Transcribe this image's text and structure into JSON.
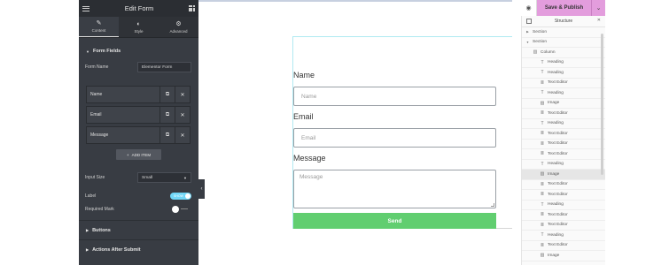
{
  "panel": {
    "header_title": "Edit Form",
    "tabs": [
      {
        "label": "Content",
        "icon": "pencil-icon"
      },
      {
        "label": "Style",
        "icon": "contrast-icon"
      },
      {
        "label": "Advanced",
        "icon": "gear-icon"
      }
    ],
    "section_title": "Form Fields",
    "form_name_label": "Form Name",
    "form_name_value": "Elementor Form",
    "fields": [
      "Name",
      "Email",
      "Message"
    ],
    "add_item_label": "ADD ITEM",
    "input_size_label": "Input Size",
    "input_size_value": "Small",
    "label_label": "Label",
    "label_toggle": "SHOW",
    "required_mark_label": "Required Mark",
    "collapsed_sections": [
      "Buttons",
      "Actions After Submit"
    ]
  },
  "form": {
    "name_label": "Name",
    "name_placeholder": "Name",
    "email_label": "Email",
    "email_placeholder": "Email",
    "message_label": "Message",
    "message_placeholder": "Message",
    "submit_label": "Send"
  },
  "topbar": {
    "publish_label": "Save & Publish"
  },
  "structure": {
    "title": "Structure",
    "items": [
      {
        "label": "Section",
        "icon": "triangle-right-icon",
        "level": 0
      },
      {
        "label": "Section",
        "icon": "triangle-down-icon",
        "level": 0
      },
      {
        "label": "Column",
        "icon": "column-icon",
        "level": 1
      },
      {
        "label": "Heading",
        "icon": "heading-icon",
        "level": 2
      },
      {
        "label": "Heading",
        "icon": "heading-icon",
        "level": 2
      },
      {
        "label": "Text Editor",
        "icon": "text-editor-icon",
        "level": 2
      },
      {
        "label": "Heading",
        "icon": "heading-icon",
        "level": 2
      },
      {
        "label": "Image",
        "icon": "image-icon",
        "level": 2
      },
      {
        "label": "Text Editor",
        "icon": "text-editor-icon",
        "level": 2
      },
      {
        "label": "Heading",
        "icon": "heading-icon",
        "level": 2
      },
      {
        "label": "Text Editor",
        "icon": "text-editor-icon",
        "level": 2
      },
      {
        "label": "Text Editor",
        "icon": "text-editor-icon",
        "level": 2
      },
      {
        "label": "Text Editor",
        "icon": "text-editor-icon",
        "level": 2
      },
      {
        "label": "Heading",
        "icon": "heading-icon",
        "level": 2
      },
      {
        "label": "Image",
        "icon": "image-icon",
        "level": 2
      },
      {
        "label": "Text Editor",
        "icon": "text-editor-icon",
        "level": 2
      },
      {
        "label": "Text Editor",
        "icon": "text-editor-icon",
        "level": 2
      },
      {
        "label": "Heading",
        "icon": "heading-icon",
        "level": 2
      },
      {
        "label": "Text Editor",
        "icon": "text-editor-icon",
        "level": 2
      },
      {
        "label": "Text Editor",
        "icon": "text-editor-icon",
        "level": 2
      },
      {
        "label": "Heading",
        "icon": "heading-icon",
        "level": 2
      },
      {
        "label": "Text Editor",
        "icon": "text-editor-icon",
        "level": 2
      },
      {
        "label": "Image",
        "icon": "image-icon",
        "level": 2
      }
    ]
  },
  "colors": {
    "panel_bg": "#383c43",
    "publish_bg": "#e39ddd",
    "submit_bg": "#61ce70",
    "toggle_on": "#71d7f7"
  }
}
